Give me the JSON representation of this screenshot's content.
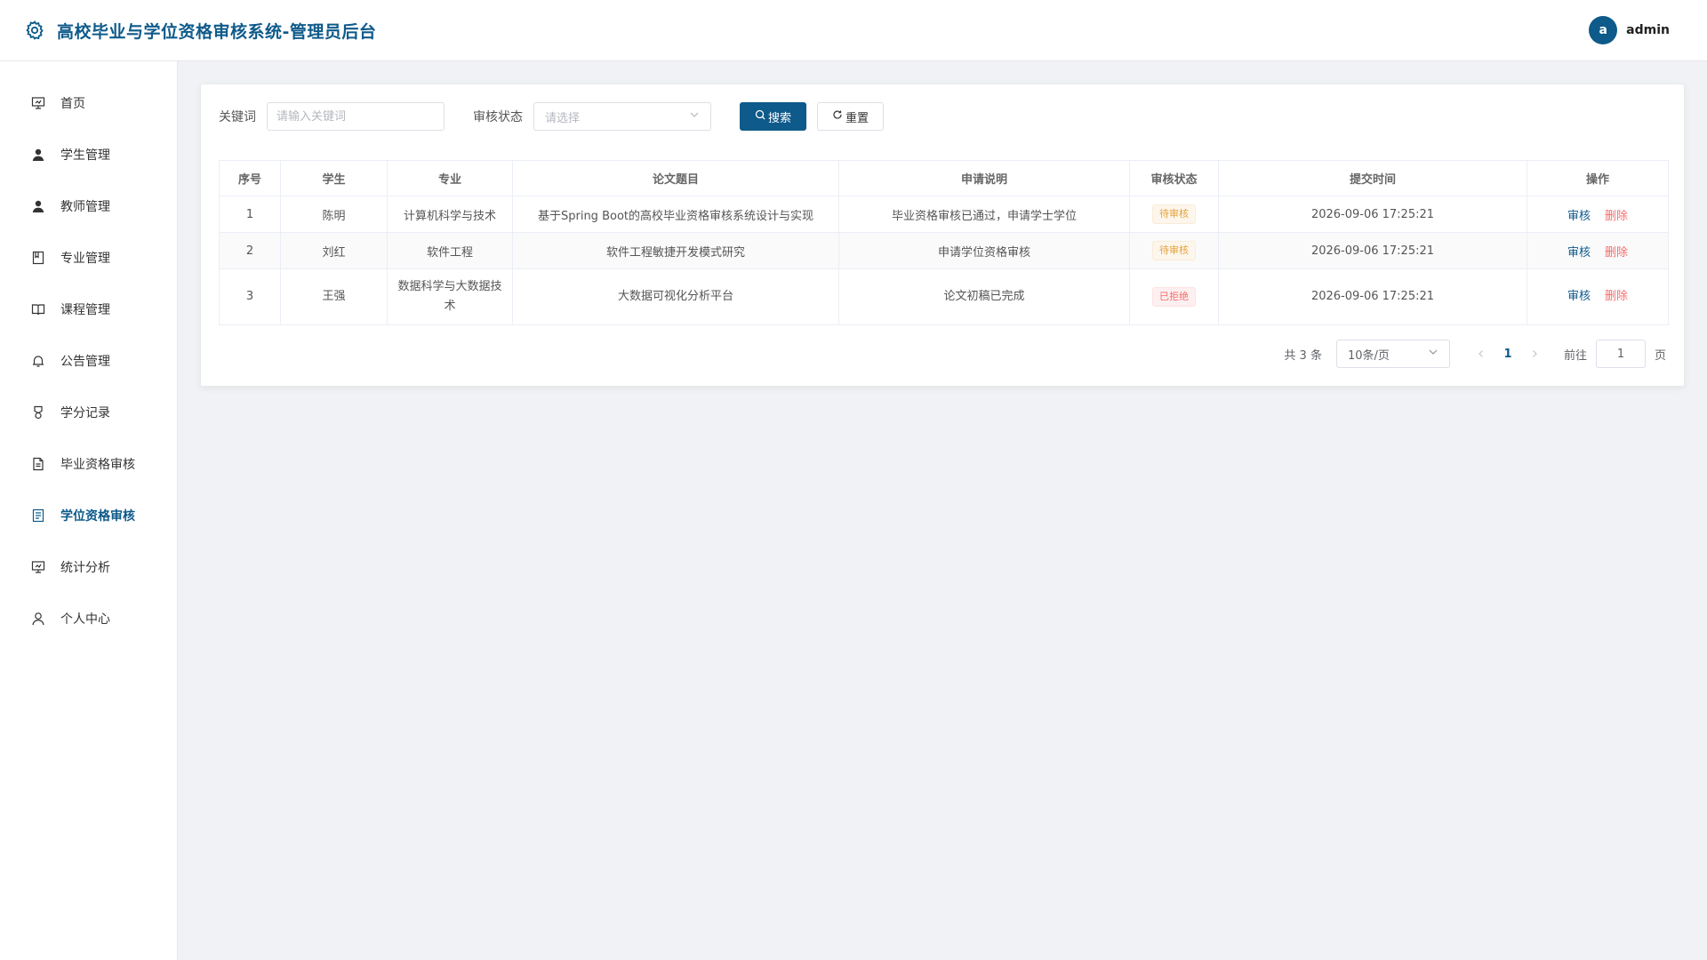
{
  "header": {
    "title": "高校毕业与学位资格审核系统-管理员后台",
    "avatar_letter": "a",
    "username": "admin"
  },
  "sidebar": {
    "items": [
      {
        "label": "首页",
        "icon": "presentation-icon"
      },
      {
        "label": "学生管理",
        "icon": "user-filled-icon"
      },
      {
        "label": "教师管理",
        "icon": "user-filled-icon"
      },
      {
        "label": "专业管理",
        "icon": "notebook-icon"
      },
      {
        "label": "课程管理",
        "icon": "book-icon"
      },
      {
        "label": "公告管理",
        "icon": "bell-icon"
      },
      {
        "label": "学分记录",
        "icon": "medal-icon"
      },
      {
        "label": "毕业资格审核",
        "icon": "document-icon"
      },
      {
        "label": "学位资格审核",
        "icon": "tickets-icon"
      },
      {
        "label": "统计分析",
        "icon": "presentation-icon"
      },
      {
        "label": "个人中心",
        "icon": "user-outline-icon"
      }
    ],
    "active_index": 8
  },
  "filters": {
    "keyword_label": "关键词",
    "keyword_placeholder": "请输入关键词",
    "status_label": "审核状态",
    "status_placeholder": "请选择",
    "search_label": "搜索",
    "reset_label": "重置"
  },
  "table": {
    "columns": [
      "序号",
      "学生",
      "专业",
      "论文题目",
      "申请说明",
      "审核状态",
      "提交时间",
      "操作"
    ],
    "rows": [
      {
        "index": "1",
        "student": "陈明",
        "major": "计算机科学与技术",
        "thesis": "基于Spring Boot的高校毕业资格审核系统设计与实现",
        "note": "毕业资格审核已通过，申请学士学位",
        "status": "待审核",
        "status_type": "pending",
        "time": "2026-09-06 17:25:21"
      },
      {
        "index": "2",
        "student": "刘红",
        "major": "软件工程",
        "thesis": "软件工程敏捷开发模式研究",
        "note": "申请学位资格审核",
        "status": "待审核",
        "status_type": "pending",
        "time": "2026-09-06 17:25:21"
      },
      {
        "index": "3",
        "student": "王强",
        "major": "数据科学与大数据技术",
        "thesis": "大数据可视化分析平台",
        "note": "论文初稿已完成",
        "status": "已拒绝",
        "status_type": "rejected",
        "time": "2026-09-06 17:25:21"
      }
    ],
    "action_audit": "审核",
    "action_delete": "删除"
  },
  "pagination": {
    "total_text": "共 3 条",
    "page_size": "10条/页",
    "current_page": "1",
    "goto_label": "前往",
    "goto_value": "1",
    "page_suffix": "页"
  },
  "colors": {
    "primary": "#0e5a8a",
    "pending": "#e6a23c",
    "rejected": "#f56c6c"
  }
}
